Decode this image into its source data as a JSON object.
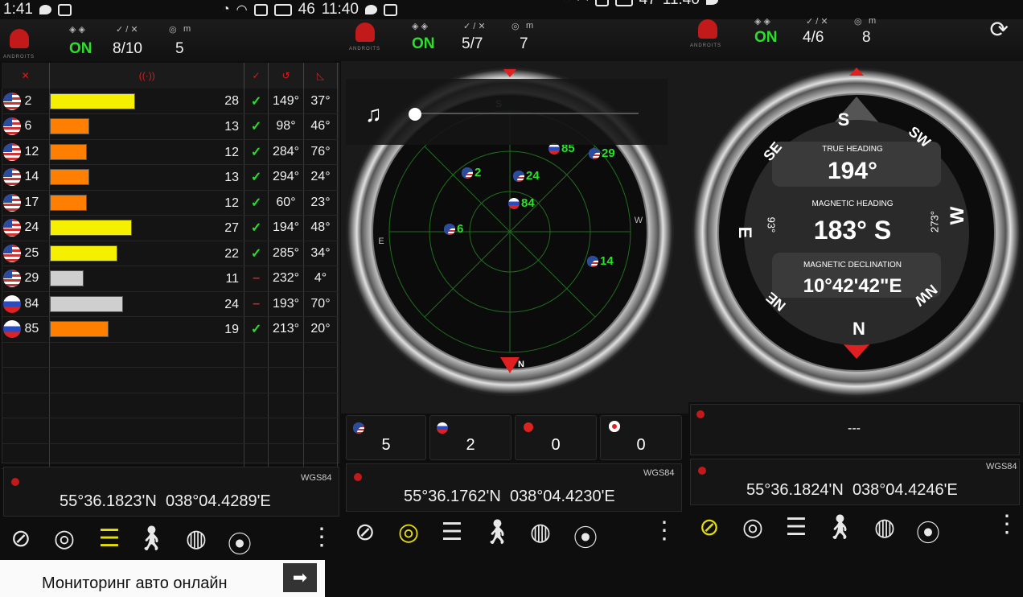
{
  "status_bar": {
    "left": {
      "time": "1:41"
    },
    "middle": {
      "level": "46",
      "time": "11:40"
    },
    "right": {
      "level": "47",
      "time": "11:40"
    }
  },
  "header": {
    "brand": "ANDROITS",
    "panels": [
      {
        "fix": "ON",
        "sats": "8/10",
        "m": "5"
      },
      {
        "fix": "ON",
        "sats": "5/7",
        "m": "7"
      },
      {
        "fix": "ON",
        "sats": "4/6",
        "m": "8"
      }
    ],
    "m_label": "m",
    "check_label": "✓ / ✕"
  },
  "sat_table": {
    "rows": [
      {
        "flag": "us",
        "id": "2",
        "snr": "28",
        "used": true,
        "az": "149°",
        "el": "37°",
        "bar_color": "#f4f000",
        "level": 0.88
      },
      {
        "flag": "us",
        "id": "6",
        "snr": "13",
        "used": true,
        "az": "98°",
        "el": "46°",
        "bar_color": "#ff7f00",
        "level": 0.41
      },
      {
        "flag": "us",
        "id": "12",
        "snr": "12",
        "used": true,
        "az": "284°",
        "el": "76°",
        "bar_color": "#ff7f00",
        "level": 0.38
      },
      {
        "flag": "us",
        "id": "14",
        "snr": "13",
        "used": true,
        "az": "294°",
        "el": "24°",
        "bar_color": "#ff7f00",
        "level": 0.41
      },
      {
        "flag": "us",
        "id": "17",
        "snr": "12",
        "used": true,
        "az": "60°",
        "el": "23°",
        "bar_color": "#ff7f00",
        "level": 0.38
      },
      {
        "flag": "us",
        "id": "24",
        "snr": "27",
        "used": true,
        "az": "194°",
        "el": "48°",
        "bar_color": "#f4f000",
        "level": 0.85
      },
      {
        "flag": "us",
        "id": "25",
        "snr": "22",
        "used": true,
        "az": "285°",
        "el": "34°",
        "bar_color": "#f4f000",
        "level": 0.7
      },
      {
        "flag": "us",
        "id": "29",
        "snr": "11",
        "used": false,
        "az": "232°",
        "el": "4°",
        "bar_color": "#cfcfcf",
        "level": 0.35
      },
      {
        "flag": "ru",
        "id": "84",
        "snr": "24",
        "used": false,
        "az": "193°",
        "el": "70°",
        "bar_color": "#cfcfcf",
        "level": 0.76
      },
      {
        "flag": "ru",
        "id": "85",
        "snr": "19",
        "used": true,
        "az": "213°",
        "el": "20°",
        "bar_color": "#ff7f00",
        "level": 0.61
      }
    ],
    "check_mark": "✓",
    "dash_mark": "–"
  },
  "radar": {
    "sats": [
      {
        "id": "2",
        "flag": "us"
      },
      {
        "id": "24",
        "flag": "us"
      },
      {
        "id": "84",
        "flag": "ru"
      },
      {
        "id": "85",
        "flag": "ru"
      },
      {
        "id": "29",
        "flag": "us"
      },
      {
        "id": "6",
        "flag": "us"
      },
      {
        "id": "14",
        "flag": "us"
      }
    ],
    "top_letter": "S",
    "bottom_letter": "N",
    "left_letter": "E",
    "right_letter": "W",
    "music_icon": "♫"
  },
  "compass": {
    "true_heading_label": "TRUE HEADING",
    "true_heading": "194°",
    "magnetic_heading_label": "MAGNETIC HEADING",
    "magnetic_heading": "183° S",
    "magnetic_declination_label": "MAGNETIC DECLINATION",
    "magnetic_declination": "10°42'42\"E",
    "left_deg": "93°",
    "right_deg": "273°",
    "cardinals": {
      "n": "N",
      "s": "S",
      "e": "E",
      "w": "W",
      "ne": "NE",
      "nw": "NW",
      "se": "SE",
      "sw": "SW"
    }
  },
  "counts": [
    {
      "system": "gps",
      "value": "5"
    },
    {
      "system": "glonass",
      "value": "2"
    },
    {
      "system": "beidou",
      "value": "0"
    },
    {
      "system": "qzss",
      "value": "0"
    }
  ],
  "altitude_value": "---",
  "coords": [
    {
      "datum": "WGS84",
      "lat": "55°36.1823'N",
      "lon": "038°04.4289'E"
    },
    {
      "datum": "WGS84",
      "lat": "55°36.1762'N",
      "lon": "038°04.4230'E"
    },
    {
      "datum": "WGS84",
      "lat": "55°36.1824'N",
      "lon": "038°04.4246'E"
    }
  ],
  "ad_banner": {
    "text": "Мониторинг авто онлайн",
    "arrow": "➡"
  },
  "colors": {
    "accent_green": "#29e029",
    "accent_red": "#e02020",
    "highlight_yellow": "#e6e000"
  }
}
